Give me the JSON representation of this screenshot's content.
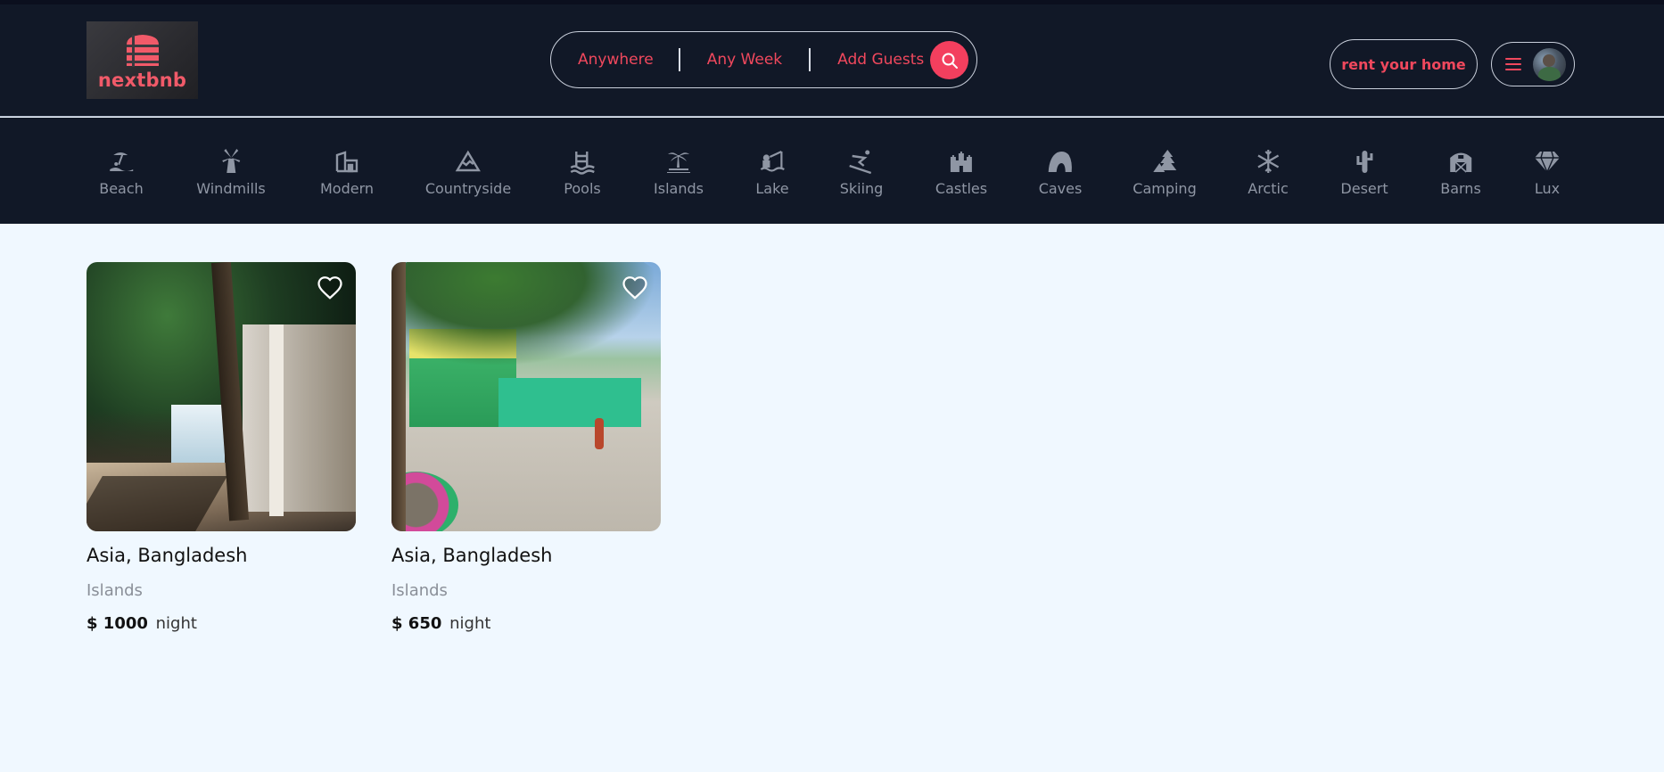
{
  "brand": {
    "logo_text": "nextbnb",
    "logo_color": "#f15a69"
  },
  "search": {
    "where": "Anywhere",
    "when": "Any Week",
    "who": "Add Guests",
    "accent": "#f33f5e"
  },
  "header": {
    "rent_label": "rent your home",
    "menu_icon": "hamburger-icon",
    "avatar": "user-avatar"
  },
  "categories": [
    {
      "label": "Beach",
      "icon": "beach-icon"
    },
    {
      "label": "Windmills",
      "icon": "windmill-icon"
    },
    {
      "label": "Modern",
      "icon": "modern-building-icon"
    },
    {
      "label": "Countryside",
      "icon": "mountain-icon"
    },
    {
      "label": "Pools",
      "icon": "pool-icon"
    },
    {
      "label": "Islands",
      "icon": "island-icon"
    },
    {
      "label": "Lake",
      "icon": "lake-icon"
    },
    {
      "label": "Skiing",
      "icon": "skiing-icon"
    },
    {
      "label": "Castles",
      "icon": "castle-icon"
    },
    {
      "label": "Caves",
      "icon": "cave-icon"
    },
    {
      "label": "Camping",
      "icon": "camping-icon"
    },
    {
      "label": "Arctic",
      "icon": "snowflake-icon"
    },
    {
      "label": "Desert",
      "icon": "cactus-icon"
    },
    {
      "label": "Barns",
      "icon": "barn-icon"
    },
    {
      "label": "Lux",
      "icon": "diamond-icon"
    }
  ],
  "listings": [
    {
      "location": "Asia, Bangladesh",
      "category": "Islands",
      "price": "$ 1000",
      "unit": "night"
    },
    {
      "location": "Asia, Bangladesh",
      "category": "Islands",
      "price": "$ 650",
      "unit": "night"
    }
  ]
}
